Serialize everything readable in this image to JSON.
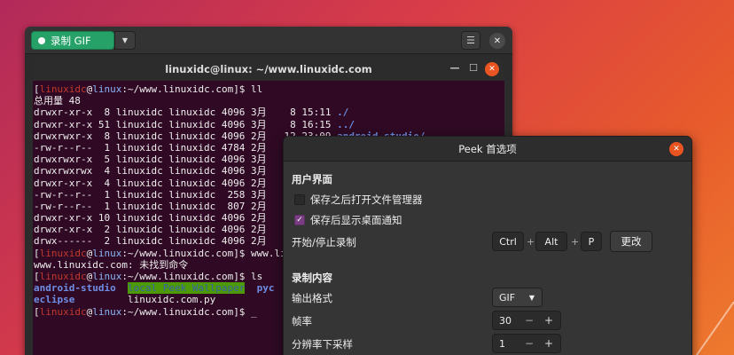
{
  "peek": {
    "record_label": "录制 GIF",
    "dropdown_icon": "chevron-down-icon",
    "menu_icon": "hamburger-icon",
    "close_icon": "close-icon"
  },
  "terminal": {
    "title": "linuxidc@linux: ~/www.linuxidc.com",
    "lines": [
      [
        {
          "t": "[",
          "c": ""
        },
        {
          "t": "linuxidc",
          "c": "pr"
        },
        {
          "t": "@",
          "c": ""
        },
        {
          "t": "linux",
          "c": "pb"
        },
        {
          "t": ":~/www.linuxidc.com]$ ll",
          "c": ""
        }
      ],
      [
        {
          "t": "总用量 48",
          "c": ""
        }
      ],
      [
        {
          "t": "drwxr-xr-x  8 linuxidc linuxidc 4096 3月    8 15:11 ",
          "c": ""
        },
        {
          "t": "./",
          "c": "dir"
        }
      ],
      [
        {
          "t": "drwxr-xr-x 51 linuxidc linuxidc 4096 3月    8 16:15 ",
          "c": ""
        },
        {
          "t": "../",
          "c": "dir"
        }
      ],
      [
        {
          "t": "drwxrwxr-x  8 linuxidc linuxidc 4096 2月   12 23:09 ",
          "c": ""
        },
        {
          "t": "android-studio/",
          "c": "dir"
        }
      ],
      [
        {
          "t": "-rw-r--r--  1 linuxidc linuxidc 4784 2月",
          "c": ""
        }
      ],
      [
        {
          "t": "drwxrwxr-x  5 linuxidc linuxidc 4096 3月",
          "c": ""
        }
      ],
      [
        {
          "t": "drwxrwxrwx  4 linuxidc linuxidc 4096 3月",
          "c": ""
        }
      ],
      [
        {
          "t": "drwxr-xr-x  4 linuxidc linuxidc 4096 2月",
          "c": ""
        }
      ],
      [
        {
          "t": "-rw-r--r--  1 linuxidc linuxidc  258 3月",
          "c": ""
        }
      ],
      [
        {
          "t": "-rw-r--r--  1 linuxidc linuxidc  807 2月",
          "c": ""
        }
      ],
      [
        {
          "t": "drwxr-xr-x 10 linuxidc linuxidc 4096 2月",
          "c": ""
        }
      ],
      [
        {
          "t": "drwxr-xr-x  2 linuxidc linuxidc 4096 2月",
          "c": ""
        }
      ],
      [
        {
          "t": "drwx------  2 linuxidc linuxidc 4096 2月",
          "c": ""
        }
      ],
      [
        {
          "t": "[",
          "c": ""
        },
        {
          "t": "linuxidc",
          "c": "pr"
        },
        {
          "t": "@",
          "c": ""
        },
        {
          "t": "linux",
          "c": "pb"
        },
        {
          "t": ":~/www.linuxidc.com]$ www.lin",
          "c": ""
        }
      ],
      [
        {
          "t": "www.linuxidc.com: 未找到命令",
          "c": ""
        }
      ],
      [
        {
          "t": "[",
          "c": ""
        },
        {
          "t": "linuxidc",
          "c": "pr"
        },
        {
          "t": "@",
          "c": ""
        },
        {
          "t": "linux",
          "c": "pb"
        },
        {
          "t": ":~/www.linuxidc.com]$ ls",
          "c": ""
        }
      ],
      [
        {
          "t": "android-studio",
          "c": "dir"
        },
        {
          "t": "  ",
          "c": ""
        },
        {
          "t": "local Peek Wallpaper",
          "c": "hl"
        },
        {
          "t": "  ",
          "c": ""
        },
        {
          "t": "pyc",
          "c": "dir"
        }
      ],
      [
        {
          "t": "eclipse",
          "c": "dir"
        },
        {
          "t": "         linuxidc.com.py",
          "c": ""
        }
      ],
      [
        {
          "t": "[",
          "c": ""
        },
        {
          "t": "linuxidc",
          "c": "pr"
        },
        {
          "t": "@",
          "c": ""
        },
        {
          "t": "linux",
          "c": "pb"
        },
        {
          "t": ":~/www.linuxidc.com]$ _",
          "c": ""
        }
      ]
    ]
  },
  "prefs": {
    "title": "Peek 首选项",
    "ui_section": "用户界面",
    "open_fm_label": "保存之后打开文件管理器",
    "open_fm_checked": false,
    "notify_label": "保存后显示桌面通知",
    "notify_checked": true,
    "shortcut_label": "开始/停止录制",
    "keys": [
      "Ctrl",
      "Alt",
      "P"
    ],
    "change_label": "更改",
    "rec_section": "录制内容",
    "format_label": "输出格式",
    "format_value": "GIF",
    "framerate_label": "帧率",
    "framerate_value": "30",
    "downsample_label": "分辨率下采样",
    "downsample_value": "1"
  }
}
